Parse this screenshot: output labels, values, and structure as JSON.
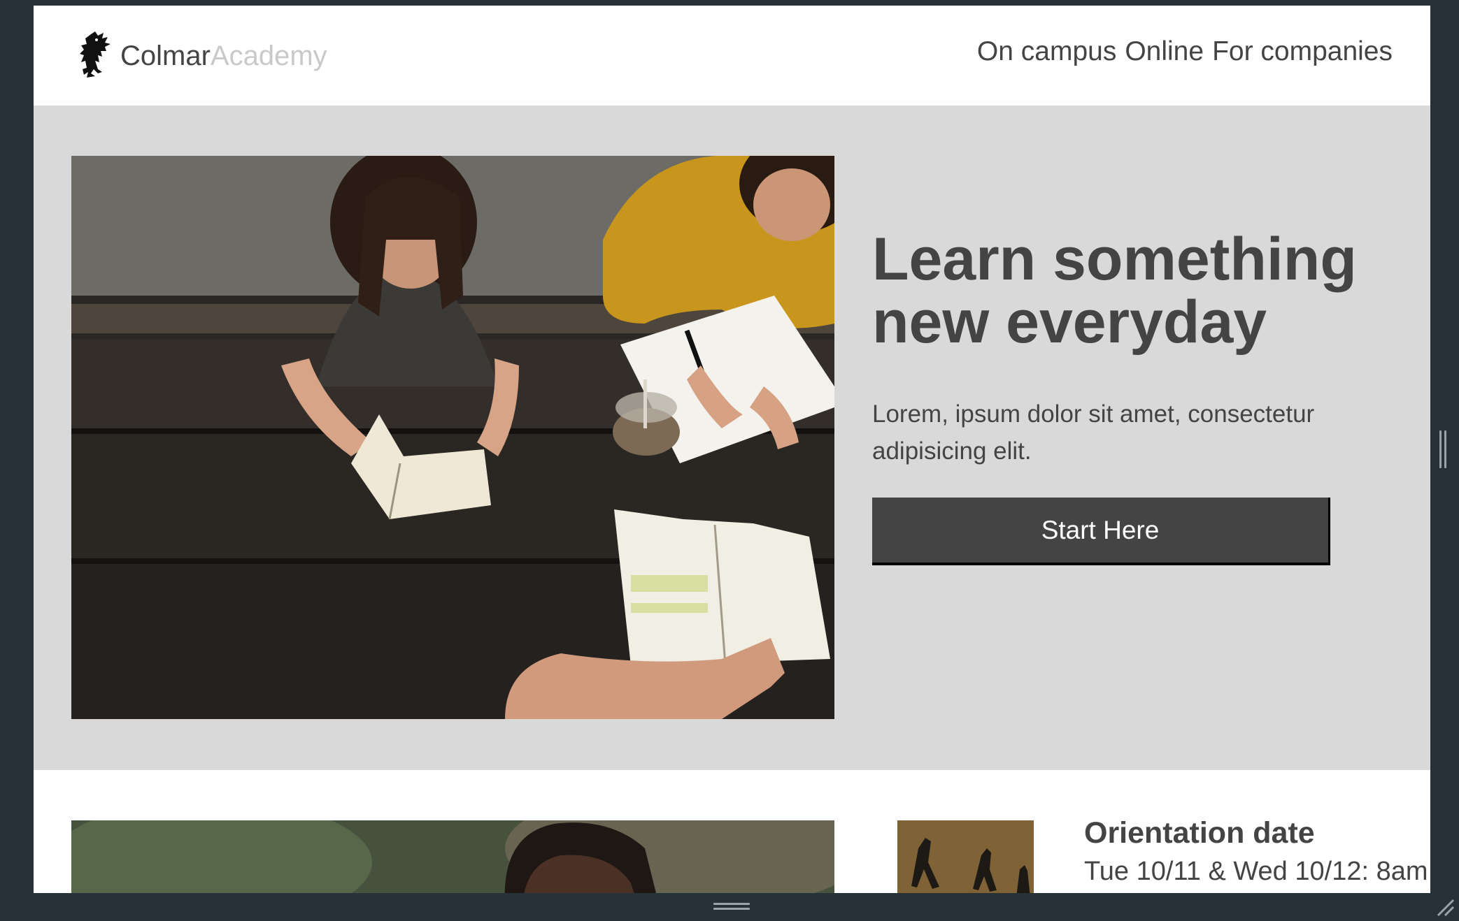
{
  "brand": {
    "name_part1": "Colmar",
    "name_part2": "Academy"
  },
  "nav": {
    "items": [
      {
        "label": "On campus"
      },
      {
        "label": "Online"
      },
      {
        "label": "For companies"
      }
    ]
  },
  "hero": {
    "title": "Learn something new everyday",
    "text": "Lorem, ipsum dolor sit amet, consectetur adipisicing elit.",
    "cta_label": "Start Here"
  },
  "event": {
    "title": "Orientation date",
    "date": "Tue 10/11 & Wed 10/12: 8am"
  },
  "colors": {
    "text": "#444444",
    "hero_bg": "#d9d9d9",
    "brand_light": "#c9c9c9",
    "window_frame": "#263238"
  }
}
